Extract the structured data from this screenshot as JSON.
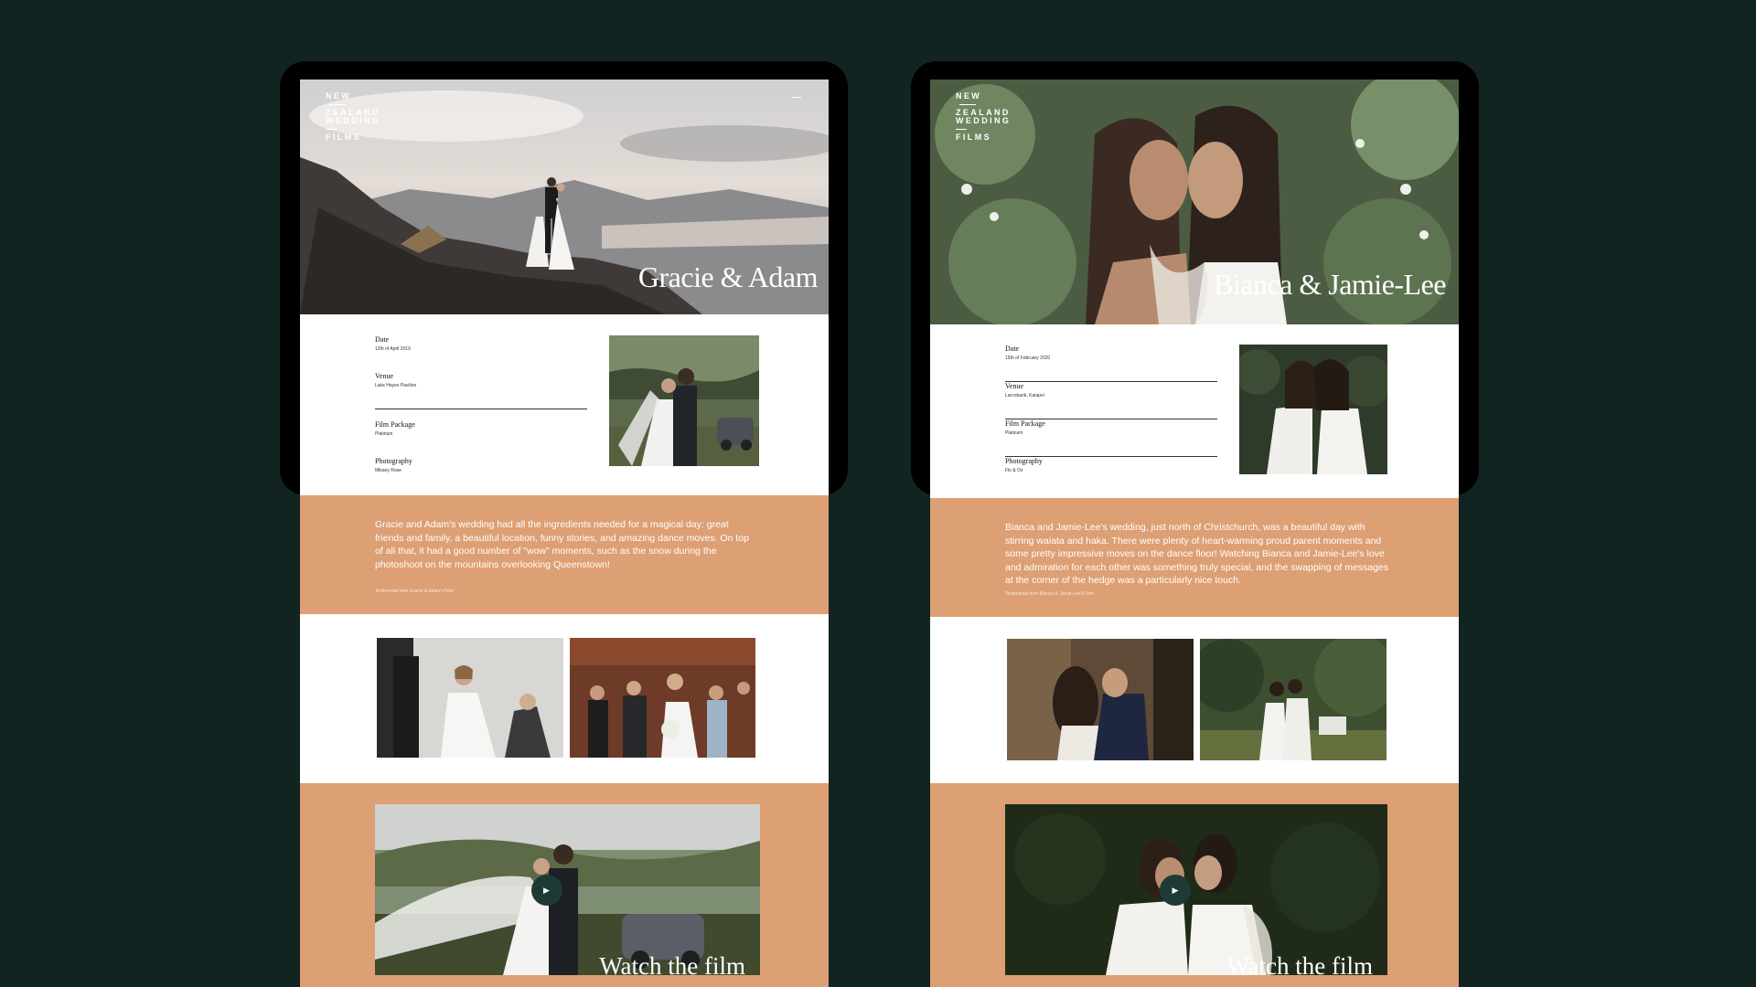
{
  "brand": {
    "logo_lines": [
      "NEW",
      "ZEALAND",
      "WEDDING",
      "FILMS"
    ]
  },
  "colors": {
    "background": "#112422",
    "accent_band": "#dd9f74",
    "play_button": "#1e3a34"
  },
  "pages": [
    {
      "couple": "Gracie & Adam",
      "details": [
        {
          "label": "Date",
          "value": "12th of April 2019"
        },
        {
          "label": "Venue",
          "value": "Lake Hayes Pavilion"
        },
        {
          "label": "Film Package",
          "value": "Platinum"
        },
        {
          "label": "Photography",
          "value": "Mikaey Rose"
        }
      ],
      "story": "Gracie and Adam's wedding had all the ingredients needed for a magical day: great friends and family, a beautiful location, funny stories, and amazing dance moves. On top of all that, it had a good number of \"wow\" moments, such as the snow during the photoshoot on the mountains overlooking Queenstown!",
      "credit": "Testimonial from Gracie & Adam's Film",
      "play_icon": "▶",
      "watch_label": "Watch the film"
    },
    {
      "couple": "Bianca & Jamie-Lee",
      "details": [
        {
          "label": "Date",
          "value": "15th of February 2020"
        },
        {
          "label": "Venue",
          "value": "Larcobank, Kaiapoi"
        },
        {
          "label": "Film Package",
          "value": "Platinum"
        },
        {
          "label": "Photography",
          "value": "Flo & Oz"
        }
      ],
      "story": "Bianca and Jamie-Lee's wedding, just north of Christchurch, was a beautiful day with stirring waiata and haka. There were plenty of heart-warming proud parent moments and some pretty impressive moves on the dance floor! Watching Bianca and Jamie-Lee's love and admiration for each other was something truly special, and the swapping of messages at the corner of the hedge was a particularly nice touch.",
      "credit": "Testimonial from Bianca & Jamie-Lee's Film",
      "play_icon": "▶",
      "watch_label": "Watch the film"
    }
  ]
}
